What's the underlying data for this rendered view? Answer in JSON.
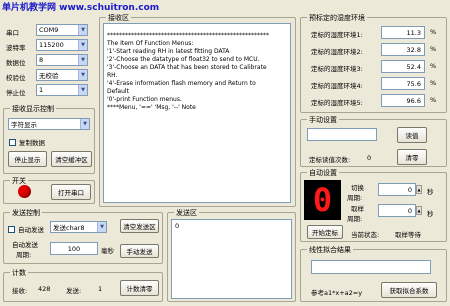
{
  "watermark": "单片机教学网 www.schuitron.com",
  "port": {
    "rows": [
      {
        "label": "串口",
        "value": "COM9"
      },
      {
        "label": "波特率",
        "value": "115200"
      },
      {
        "label": "数据位",
        "value": "8"
      },
      {
        "label": "校验位",
        "value": "无校验"
      },
      {
        "label": "停止位",
        "value": "1"
      }
    ]
  },
  "receive_ctrl": {
    "title": "接收显示控制",
    "mode": "字符显示",
    "copy_data": "复制数据",
    "stop_display": "停止显示",
    "clear_buffer": "清空缓冲区"
  },
  "switch": {
    "title": "开关",
    "open_port": "打开串口",
    "led_color": "#e60000"
  },
  "receive_area": {
    "title": "接收区",
    "lines": [
      "******************************************************",
      "The Item Of Function Menus:",
      "'1'-Start reading RH in latest fitting DATA",
      "'2'-Choose the datatype of float32 to send to MCU.",
      "'3'-Choose an DATA that has been stored to Calibrate",
      "RH.",
      "'4'-Erase information flash memory and Return to",
      "Default",
      "'0'-print Function menus.",
      "****Menu, '==' 'Msg, '--' Note"
    ]
  },
  "send_ctrl": {
    "title": "发送控制",
    "auto_send": "自动发送",
    "send_type": "发送char8",
    "clear_send": "清空发送区",
    "auto_period_label": "自动发送",
    "period_label": "周期:",
    "period_value": "100",
    "unit": "毫秒",
    "manual_send": "手动发送"
  },
  "send_area": {
    "title": "发送区",
    "content": "0"
  },
  "counter": {
    "title": "计数",
    "recv_label": "接收:",
    "recv_value": "428",
    "send_label": "发送:",
    "send_value": "1",
    "clear": "计数清零"
  },
  "setpoints": {
    "title": "预标定的湿度环境",
    "unit": "%",
    "items": [
      {
        "label": "定标的湿度环境1:",
        "value": "11.3"
      },
      {
        "label": "定标的湿度环境2:",
        "value": "32.8"
      },
      {
        "label": "定标的湿度环境3:",
        "value": "52.4"
      },
      {
        "label": "定标的湿度环境4:",
        "value": "75.6"
      },
      {
        "label": "定标的湿度环境5:",
        "value": "96.6"
      }
    ]
  },
  "manual": {
    "title": "手动设置",
    "input_value": "",
    "read": "读值",
    "count_label": "定标读值次数:",
    "count_value": "0",
    "clear": "清零"
  },
  "auto": {
    "title": "自动设置",
    "digit": "0",
    "switch_label": "切换",
    "period_label": "周期:",
    "switch_value": "0",
    "switch_unit": "秒",
    "sample_label": "取样",
    "sample_value": "0",
    "sample_unit": "秒",
    "start": "开始定标",
    "status_label": "当前状态:",
    "status_value": "取样等待"
  },
  "linear": {
    "title": "线性拟合结果",
    "result": "",
    "formula": "参考a1*x+a2=y",
    "get": "获取拟合系数"
  }
}
